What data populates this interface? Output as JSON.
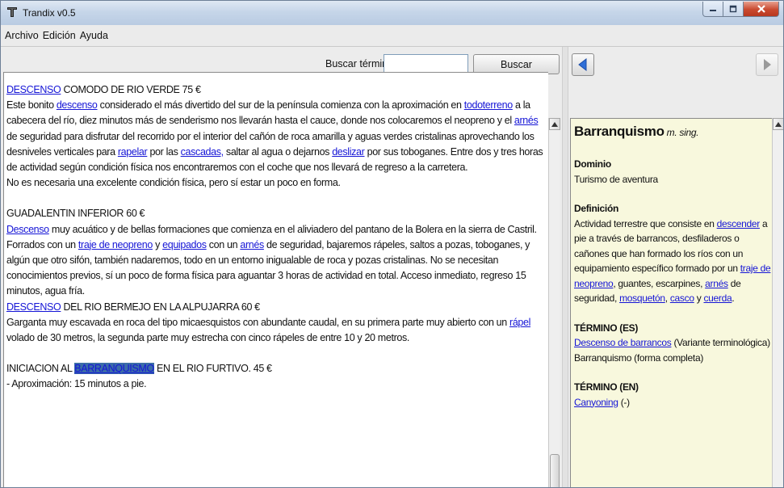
{
  "window": {
    "title": "Trandix v0.5"
  },
  "menu": [
    {
      "label": "Archivo"
    },
    {
      "label": "Edición"
    },
    {
      "label": "Ayuda"
    }
  ],
  "search": {
    "label": "Buscar término:",
    "value": "",
    "button": "Buscar"
  },
  "text": {
    "p1": {
      "l1": "DESCENSO",
      "t1": " COMODO DE RIO VERDE 75 €",
      "t2": "Este bonito ",
      "l2": "descenso",
      "t3": " considerado el más divertido del sur de la península comienza con la aproximación en ",
      "l3": "todoterreno",
      "t4": " a la cabecera del río, diez minutos más de senderismo nos llevarán hasta el cauce, donde nos colocaremos el neopreno y el ",
      "l4": "arnés",
      "t5": " de seguridad para disfrutar del recorrido por el interior del cañón de roca amarilla y aguas verdes cristalinas aprovechando los desniveles verticales para ",
      "l5": "rapelar",
      "t6": " por las ",
      "l6": "cascadas,",
      "t7": " saltar al agua o dejarnos ",
      "l7": "deslizar",
      "t8": " por sus toboganes. Entre dos y tres horas de actividad según condición física nos encontraremos con el coche que nos llevará de regreso a la carretera."
    },
    "p2": "No es necesaria una excelente condición física, pero sí estar un poco en forma.",
    "p3": "GUADALENTIN INFERIOR 60 €",
    "p4": {
      "l1": "Descenso",
      "t1": " muy acuático y de bellas formaciones que comienza en el aliviadero del pantano de la Bolera en la sierra de Castril. Forrados con un ",
      "l2": "traje de neopreno",
      "t2": " y ",
      "l3": "equipados",
      "t3": " con un ",
      "l4": "arnés",
      "t4": " de seguridad, bajaremos rápeles, saltos a pozas, toboganes, y algún que otro sifón, también nadaremos, todo en un entorno inigualable de roca y pozas cristalinas. No se necesitan conocimientos previos, sí un poco de forma física para aguantar 3 horas de actividad en total. Acceso inmediato, regreso 15 minutos, agua fría."
    },
    "p5": {
      "l1": "DESCENSO",
      "t1": " DEL RIO BERMEJO EN LA ALPUJARRA 60 €"
    },
    "p6": {
      "t1": "Garganta muy escavada en roca del tipo micaesquistos con abundante caudal, en su primera parte muy abierto con un ",
      "l1": "rápel",
      "t2": " volado de 30 metros, la segunda parte muy estrecha con cinco rápeles de entre 10 y 20 metros."
    },
    "p7": {
      "t1": "INICIACION AL ",
      "h1": "BARRANQUISMO",
      "t2": " EN EL RIO FURTIVO. 45 €"
    },
    "p8": "- Aproximación: 15 minutos a pie."
  },
  "definition": {
    "term": "Barranquismo",
    "grammar": "m. sing.",
    "domain_label": "Dominio",
    "domain_value": "Turismo de aventura",
    "def_label": "Definición",
    "def": {
      "t1": "Actividad terrestre que consiste en ",
      "l1": "descender",
      "t2": " a pie a través de barrancos, desfiladeros o cañones que han formado los ríos con un equipamiento específico formado por un ",
      "l2": "traje de neopreno",
      "t3": ", guantes, escarpines, ",
      "l3": "arnés",
      "t4": " de seguridad, ",
      "l4": "mosquetón",
      "t5": ", ",
      "l5": "casco",
      "t6": " y ",
      "l6": "cuerda",
      "t7": "."
    },
    "term_es_label": "TÉRMINO (ES)",
    "term_es": {
      "l1": "Descenso de barrancos",
      "t1": " (Variante terminológica)",
      "t2": "Barranquismo (forma completa)"
    },
    "term_en_label": "TÉRMINO (EN)",
    "term_en": {
      "l1": "Canyoning",
      "t1": " (-)"
    }
  },
  "colors": {
    "link": "#1515d6",
    "highlight": "#3b6da7",
    "definition_bg": "#f8f8dd",
    "close_button": "#c9492f"
  },
  "icons": {
    "app": "trandix-logo-icon",
    "back": "arrow-left-icon",
    "forward": "arrow-right-icon"
  }
}
